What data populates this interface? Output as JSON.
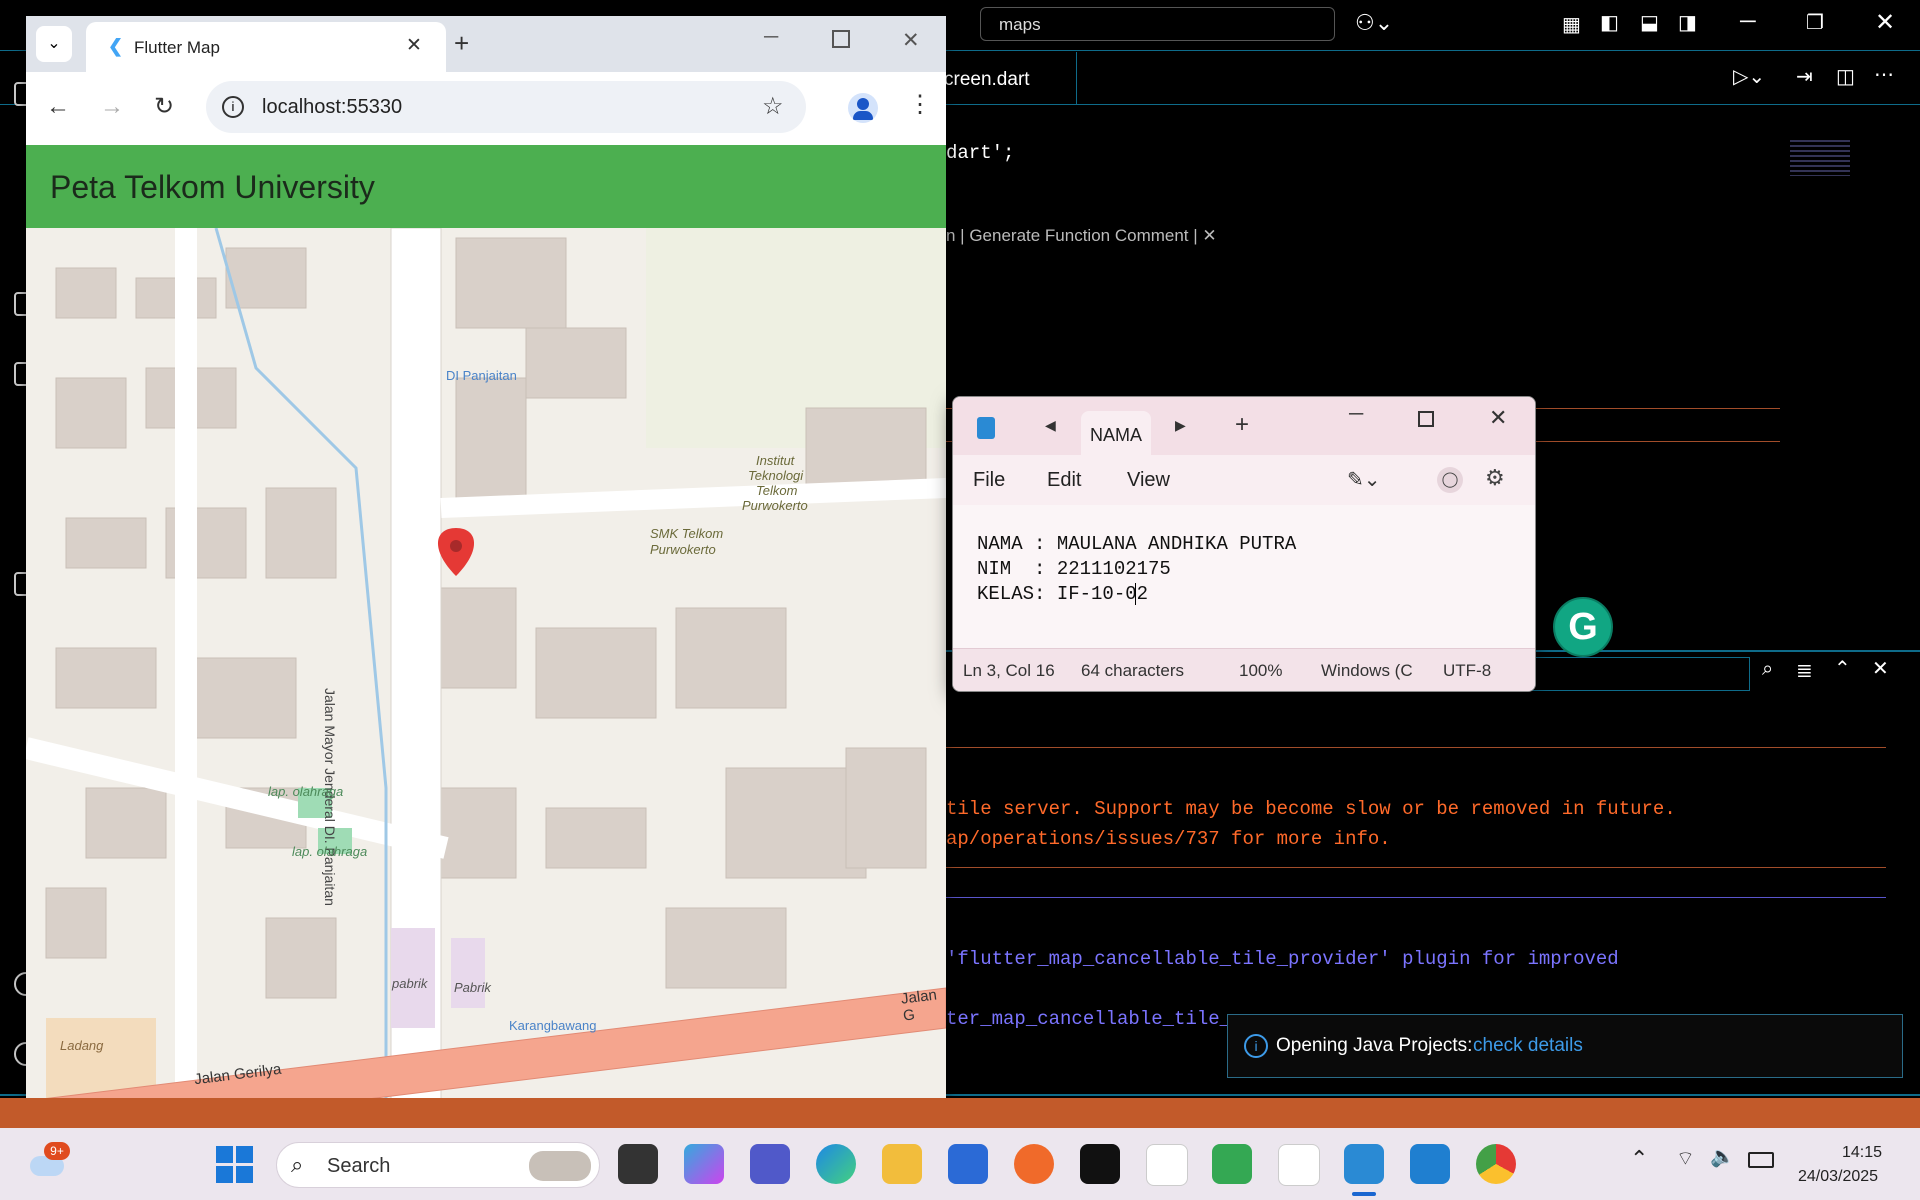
{
  "vscode": {
    "search_text": "maps",
    "tab_label": "creen.dart",
    "code_lines": [
      "dart';"
    ],
    "codelens": "n | Generate Function Comment | ✕",
    "terminal_lines": [
      "tile server. Support may be become slow or be removed in future.",
      "ap/operations/issues/737 for more info.",
      "'flutter_map_cancellable_tile_provider' plugin for improved",
      "ter_map_cancellable_tile_"
    ],
    "colors": {
      "accent": "#0e6b8a",
      "warning": "#ff6a2a",
      "info": "#7b74ff",
      "divider_orange": "#a24d2a"
    }
  },
  "chrome": {
    "tab_title": "Flutter Map",
    "url": "localhost:55330",
    "app_title": "Peta Telkom University",
    "appbar_color": "#4caf50"
  },
  "map": {
    "labels": {
      "poi_bus1": "DI Panjaitan",
      "road_main": "Jalan Mayor Jenderal DI. Panjaitan",
      "inst1": "Institut",
      "inst2": "Teknologi",
      "inst3": "Telkom",
      "inst4": "Purwokerto",
      "smk1": "SMK Telkom",
      "smk2": "Purwokerto",
      "lap1": "lap. olahraga",
      "lap2": "lap. olahraga",
      "pabrik1": "pabrik",
      "pabrik2": "Pabrik",
      "bus2": "Karangbawang",
      "ladang": "Ladang",
      "jalan_gerilya": "Jalan Gerilya",
      "jalan_g": "Jalan G"
    },
    "marker_color": "#e53935"
  },
  "notepad": {
    "tab": "NAMA",
    "menu": [
      "File",
      "Edit",
      "View"
    ],
    "lines": [
      "NAMA : MAULANA ANDHIKA PUTRA",
      "NIM  : 2211102175",
      "KELAS: IF-10-02"
    ],
    "status": {
      "position": "Ln 3, Col 16",
      "chars": "64 characters",
      "zoom": "100%",
      "eol": "Windows (C",
      "encoding": "UTF-8"
    }
  },
  "notification": {
    "text": "Opening Java Projects:",
    "link": "check details"
  },
  "taskbar": {
    "weather_badge": "9+",
    "search_placeholder": "Search",
    "time": "14:15",
    "date": "24/03/2025"
  }
}
